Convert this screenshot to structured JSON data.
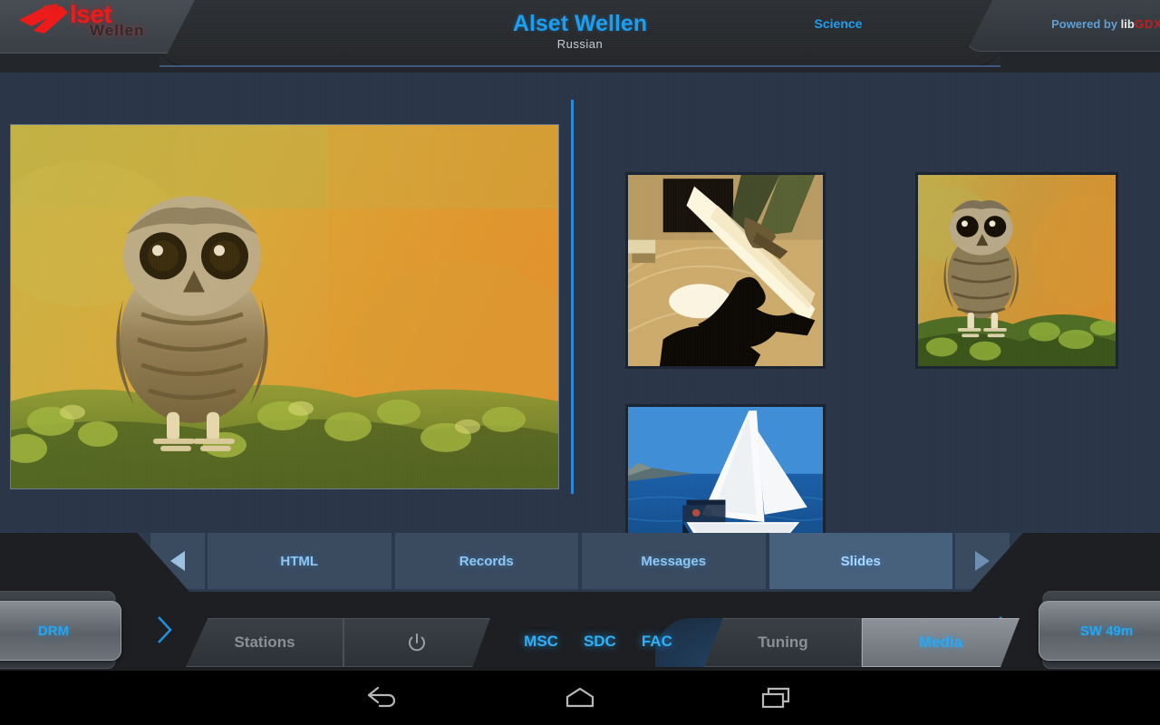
{
  "header": {
    "logo_word": "lset",
    "logo_sub": "Wellen",
    "logo_icon": "alset-arrow-logo",
    "station_title": "Alset Wellen",
    "station_language": "Russian",
    "genre": "Science",
    "powered_prefix": "Powered by ",
    "powered_lib": "lib",
    "powered_gdx": "GDX"
  },
  "content": {
    "main_slide_alt": "owl perched on mossy log, pixelated slideshow image",
    "thumbnails": [
      {
        "name": "thumbnail-gym",
        "alt": "sepia gymnasium floor with silhouette"
      },
      {
        "name": "thumbnail-owl",
        "alt": "owl perched on mossy log"
      },
      {
        "name": "thumbnail-sailboat",
        "alt": "white sailboat on blue sea"
      }
    ]
  },
  "tabs": {
    "prev_label": "◀",
    "next_label": "▶",
    "items": [
      {
        "label": "HTML",
        "active": false
      },
      {
        "label": "Records",
        "active": false
      },
      {
        "label": "Messages",
        "active": false
      },
      {
        "label": "Slides",
        "active": true
      }
    ]
  },
  "carousels": {
    "left": {
      "label": "DRM",
      "chevron": "›"
    },
    "right": {
      "label": "SW 49m",
      "chevron": "‹"
    }
  },
  "console": {
    "stations_label": "Stations",
    "power_label": "power-icon",
    "tuning_label": "Tuning",
    "media_label": "Media",
    "codes": [
      "MSC",
      "SDC",
      "FAC"
    ]
  },
  "navbar": {
    "back_label": "back-icon",
    "home_label": "home-icon",
    "recents_label": "recents-icon"
  },
  "colors": {
    "accent_blue": "#2ba8f2",
    "title_blue": "#1d9ff0",
    "brand_red": "#ee1b1b",
    "content_bg": "#2a3647",
    "tab_bg": "#3a4b60",
    "tab_active_bg": "#47607c",
    "divider": "#2b88d8"
  }
}
